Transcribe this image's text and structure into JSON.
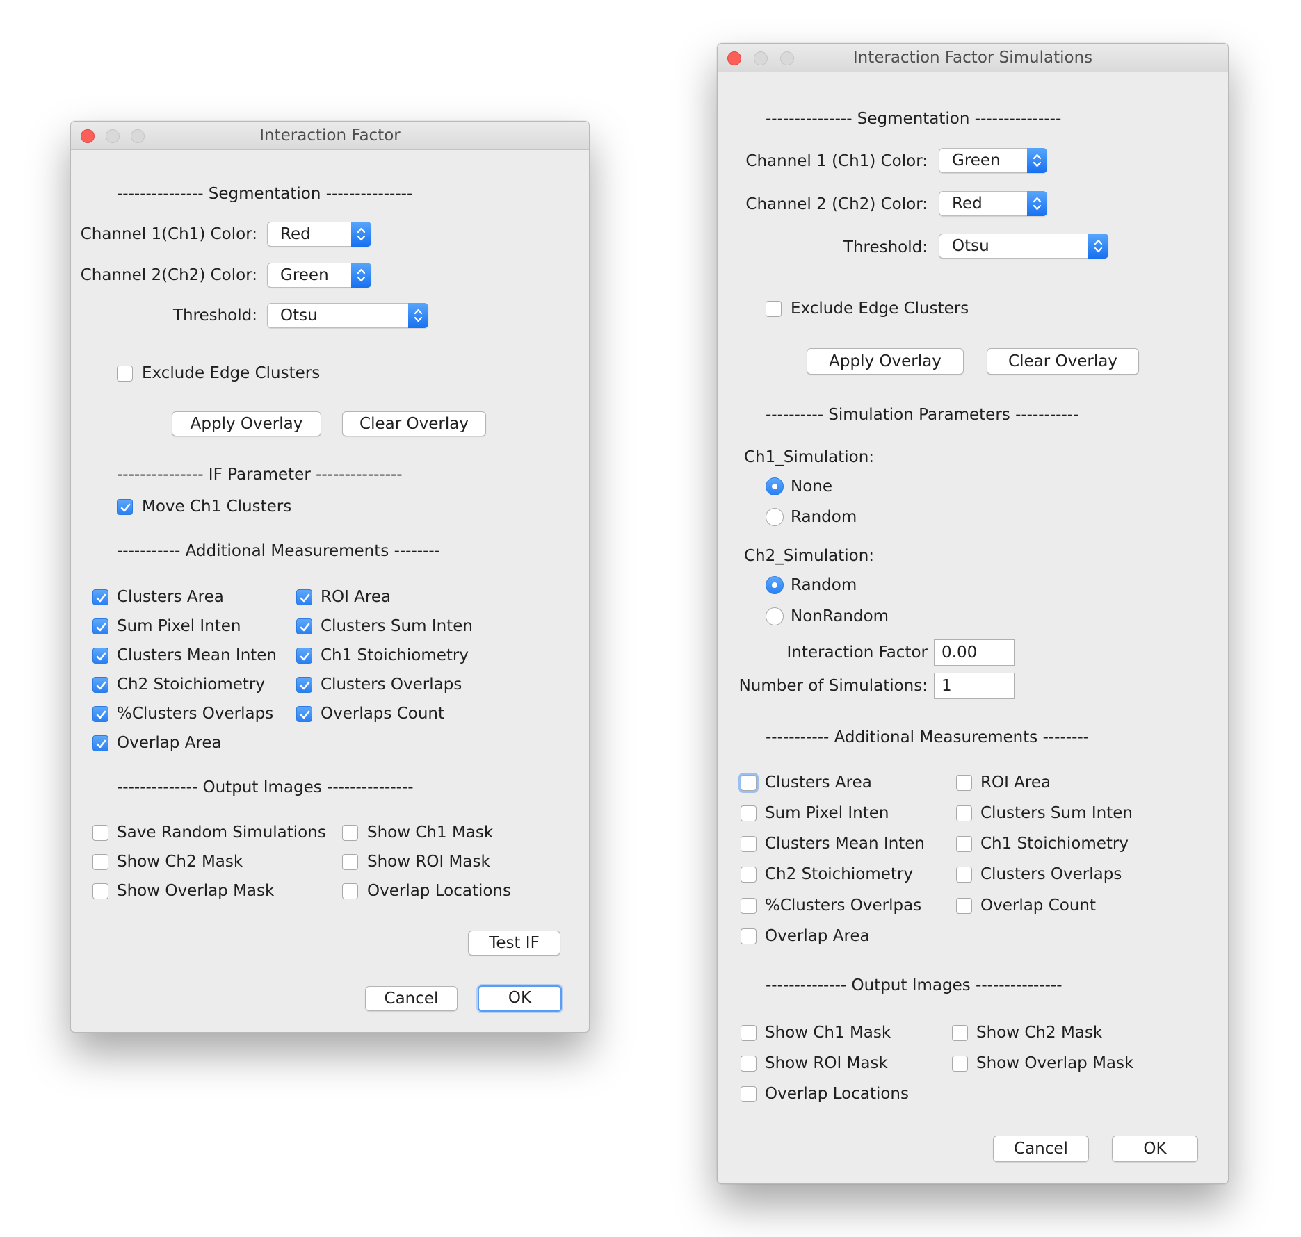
{
  "left_window": {
    "title": "Interaction Factor",
    "segmentation_header": "--------------- Segmentation ---------------",
    "ch1_label": "Channel 1(Ch1) Color:",
    "ch1_value": "Red",
    "ch2_label": "Channel 2(Ch2) Color:",
    "ch2_value": "Green",
    "threshold_label": "Threshold:",
    "threshold_value": "Otsu",
    "exclude_edge_label": "Exclude Edge Clusters",
    "apply_overlay": "Apply Overlay",
    "clear_overlay": "Clear Overlay",
    "if_header": "--------------- IF Parameter ---------------",
    "move_ch1_label": "Move Ch1 Clusters",
    "measurements_header": "----------- Additional Measurements --------",
    "measurements": [
      {
        "label": "Clusters Area",
        "checked": true
      },
      {
        "label": "ROI Area",
        "checked": true
      },
      {
        "label": "Sum Pixel Inten",
        "checked": true
      },
      {
        "label": "Clusters Sum Inten",
        "checked": true
      },
      {
        "label": "Clusters Mean Inten",
        "checked": true
      },
      {
        "label": "Ch1 Stoichiometry",
        "checked": true
      },
      {
        "label": "Ch2 Stoichiometry",
        "checked": true
      },
      {
        "label": "Clusters Overlaps",
        "checked": true
      },
      {
        "label": "%Clusters Overlaps",
        "checked": true
      },
      {
        "label": "Overlaps Count",
        "checked": true
      },
      {
        "label": "Overlap Area",
        "checked": true
      }
    ],
    "output_header": "-------------- Output Images ---------------",
    "outputs": [
      {
        "label": "Save Random Simulations",
        "checked": false
      },
      {
        "label": "Show Ch1 Mask",
        "checked": false
      },
      {
        "label": "Show Ch2 Mask",
        "checked": false
      },
      {
        "label": "Show ROI Mask",
        "checked": false
      },
      {
        "label": "Show Overlap Mask",
        "checked": false
      },
      {
        "label": "Overlap Locations",
        "checked": false
      }
    ],
    "test_if": "Test IF",
    "cancel": "Cancel",
    "ok": "OK"
  },
  "right_window": {
    "title": "Interaction Factor Simulations",
    "segmentation_header": "--------------- Segmentation ---------------",
    "ch1_label": "Channel 1 (Ch1) Color:",
    "ch1_value": "Green",
    "ch2_label": "Channel 2 (Ch2) Color:",
    "ch2_value": "Red",
    "threshold_label": "Threshold:",
    "threshold_value": "Otsu",
    "exclude_edge_label": "Exclude Edge Clusters",
    "apply_overlay": "Apply Overlay",
    "clear_overlay": "Clear Overlay",
    "sim_header": "---------- Simulation Parameters -----------",
    "ch1_sim_label": "Ch1_Simulation:",
    "ch1_sim_options": [
      "None",
      "Random"
    ],
    "ch1_sim_selected": "None",
    "ch2_sim_label": "Ch2_Simulation:",
    "ch2_sim_options": [
      "Random",
      "NonRandom"
    ],
    "ch2_sim_selected": "Random",
    "if_label": "Interaction Factor",
    "if_value": "0.00",
    "nsim_label": "Number of Simulations:",
    "nsim_value": "1",
    "measurements_header": "----------- Additional Measurements --------",
    "measurements": [
      {
        "label": "Clusters Area",
        "checked": false
      },
      {
        "label": "ROI Area",
        "checked": false
      },
      {
        "label": "Sum Pixel Inten",
        "checked": false
      },
      {
        "label": "Clusters Sum Inten",
        "checked": false
      },
      {
        "label": "Clusters Mean Inten",
        "checked": false
      },
      {
        "label": "Ch1 Stoichiometry",
        "checked": false
      },
      {
        "label": "Ch2 Stoichiometry",
        "checked": false
      },
      {
        "label": "Clusters Overlaps",
        "checked": false
      },
      {
        "label": "%Clusters Overlpas",
        "checked": false
      },
      {
        "label": "Overlap Count",
        "checked": false
      },
      {
        "label": "Overlap Area",
        "checked": false
      }
    ],
    "output_header": "-------------- Output Images ---------------",
    "outputs": [
      {
        "label": "Show Ch1 Mask",
        "checked": false
      },
      {
        "label": "Show Ch2 Mask",
        "checked": false
      },
      {
        "label": "Show ROI Mask",
        "checked": false
      },
      {
        "label": "Show Overlap Mask",
        "checked": false
      },
      {
        "label": "Overlap Locations",
        "checked": false
      }
    ],
    "cancel": "Cancel",
    "ok": "OK"
  }
}
